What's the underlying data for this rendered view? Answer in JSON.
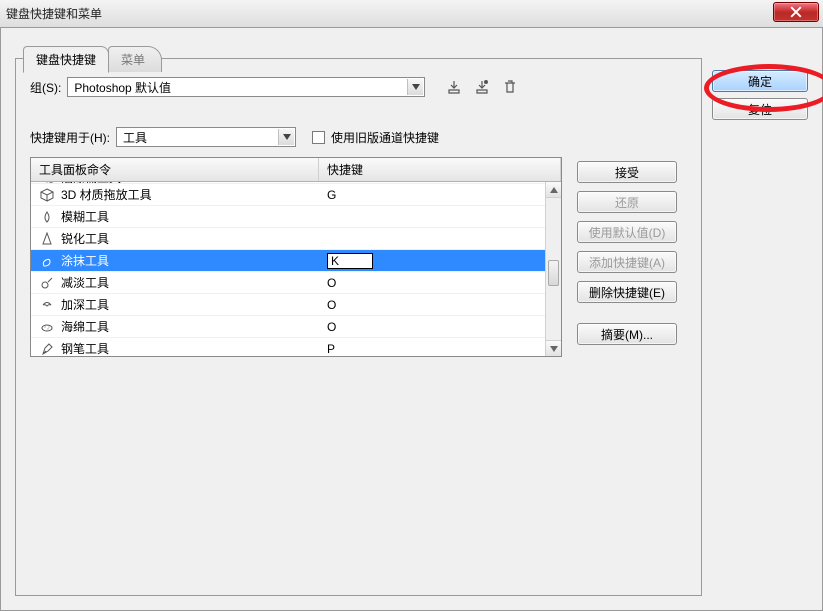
{
  "window": {
    "title": "键盘快捷键和菜单"
  },
  "tabs": {
    "active": "键盘快捷键",
    "inactive": "菜单"
  },
  "set": {
    "label": "组(S):",
    "value": "Photoshop 默认值"
  },
  "shortcuts_for": {
    "label": "快捷键用于(H):",
    "value": "工具"
  },
  "legacy_checkbox": {
    "label": "使用旧版通道快捷键",
    "checked": false
  },
  "table": {
    "header_col1": "工具面板命令",
    "header_col2": "快捷键",
    "rows": [
      {
        "icon": "paint-bucket-icon",
        "name": "油漆桶工具",
        "shortcut": "G",
        "partial": true
      },
      {
        "icon": "cube-icon",
        "name": "3D 材质拖放工具",
        "shortcut": "G"
      },
      {
        "icon": "drop-icon",
        "name": "模糊工具",
        "shortcut": ""
      },
      {
        "icon": "sharpen-icon",
        "name": "锐化工具",
        "shortcut": ""
      },
      {
        "icon": "smudge-icon",
        "name": "涂抹工具",
        "shortcut": "K",
        "selected": true,
        "editing": true
      },
      {
        "icon": "dodge-icon",
        "name": "减淡工具",
        "shortcut": "O"
      },
      {
        "icon": "burn-icon",
        "name": "加深工具",
        "shortcut": "O"
      },
      {
        "icon": "sponge-icon",
        "name": "海绵工具",
        "shortcut": "O"
      },
      {
        "icon": "pen-icon",
        "name": "钢笔工具",
        "shortcut": "P"
      }
    ]
  },
  "right_buttons": {
    "ok": "确定",
    "reset": "复位"
  },
  "inner_buttons": {
    "accept": "接受",
    "undo": "还原",
    "use_default": "使用默认值(D)",
    "add_shortcut": "添加快捷键(A)",
    "delete_shortcut": "删除快捷键(E)",
    "summary": "摘要(M)..."
  }
}
